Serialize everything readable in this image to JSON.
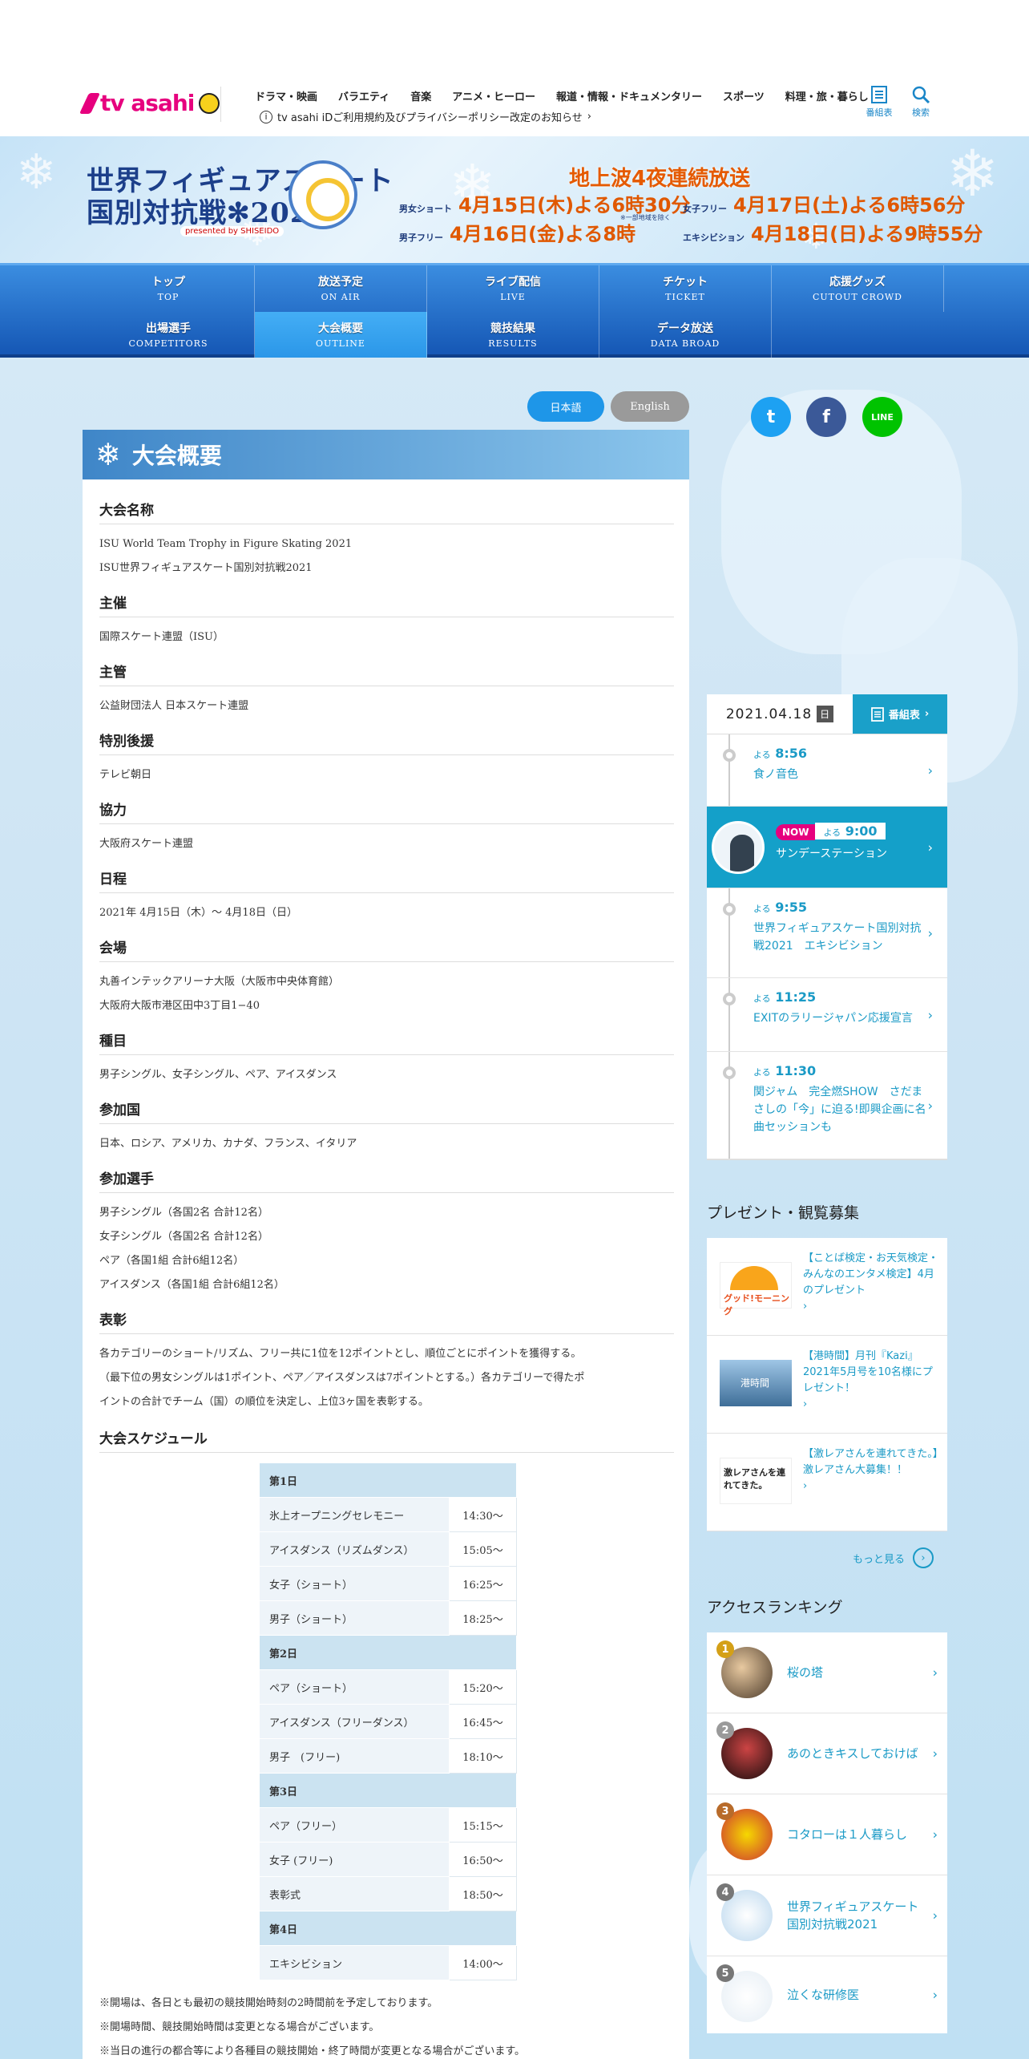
{
  "header": {
    "logo_text": "tv asahi",
    "nav": [
      "ドラマ・映画",
      "バラエティ",
      "音楽",
      "アニメ・ヒーロー",
      "報道・情報・ドキュメンタリー",
      "スポーツ",
      "料理・旅・暮らし"
    ],
    "notice": "tv asahi iDご利用規約及びプライバシーポリシー改定のお知らせ",
    "program_label": "番組表",
    "search_label": "検索"
  },
  "banner": {
    "title_line1": "世界フィギュアスケート",
    "title_line2": "国別対抗戦",
    "title_year": "2021",
    "sponsor": "presented by SHISEIDO",
    "headline": "地上波4夜連続放送",
    "rows": [
      {
        "label": "男女ショート",
        "value": "4月15日(木)よる6時30分",
        "note": "※一部地域を除く"
      },
      {
        "label": "女子フリー",
        "value": "4月17日(土)よる6時56分"
      },
      {
        "label": "男子フリー",
        "value": "4月16日(金)よる8時"
      },
      {
        "label": "エキシビション",
        "value": "4月18日(日)よる9時55分"
      }
    ]
  },
  "nav": [
    {
      "jp": "トップ",
      "en": "TOP"
    },
    {
      "jp": "放送予定",
      "en": "ON AIR"
    },
    {
      "jp": "ライブ配信",
      "en": "LIVE"
    },
    {
      "jp": "チケット",
      "en": "TICKET"
    },
    {
      "jp": "応援グッズ",
      "en": "CUTOUT CROWD"
    },
    {
      "jp": "出場選手",
      "en": "COMPETITORS"
    },
    {
      "jp": "大会概要",
      "en": "OUTLINE"
    },
    {
      "jp": "競技結果",
      "en": "RESULTS"
    },
    {
      "jp": "データ放送",
      "en": "DATA BROAD"
    }
  ],
  "lang": {
    "ja": "日本語",
    "en": "English"
  },
  "content": {
    "title": "大会概要",
    "sections": [
      {
        "h": "大会名称",
        "lines": [
          "ISU World Team Trophy in Figure Skating 2021",
          "ISU世界フィギュアスケート国別対抗戦2021"
        ]
      },
      {
        "h": "主催",
        "lines": [
          "国際スケート連盟（ISU）"
        ]
      },
      {
        "h": "主管",
        "lines": [
          "公益財団法人 日本スケート連盟"
        ]
      },
      {
        "h": "特別後援",
        "lines": [
          "テレビ朝日"
        ]
      },
      {
        "h": "協力",
        "lines": [
          "大阪府スケート連盟"
        ]
      },
      {
        "h": "日程",
        "lines": [
          "2021年 4月15日（木）～ 4月18日（日）"
        ]
      },
      {
        "h": "会場",
        "lines": [
          "丸善インテックアリーナ大阪（大阪市中央体育館）",
          "大阪府大阪市港区田中3丁目1−40"
        ]
      },
      {
        "h": "種目",
        "lines": [
          "男子シングル、女子シングル、ペア、アイスダンス"
        ]
      },
      {
        "h": "参加国",
        "lines": [
          "日本、ロシア、アメリカ、カナダ、フランス、イタリア"
        ]
      },
      {
        "h": "参加選手",
        "lines": [
          "男子シングル（各国2名 合計12名）",
          "女子シングル（各国2名 合計12名）",
          "ペア（各国1組 合計6組12名）",
          "アイスダンス（各国1組 合計6組12名）"
        ]
      },
      {
        "h": "表彰",
        "lines": [
          "各カテゴリーのショート/リズム、フリー共に1位を12ポイントとし、順位ごとにポイントを獲得する。",
          "（最下位の男女シングルは1ポイント、ペア／アイスダンスは7ポイントとする。）各カテゴリーで得たポ",
          "イントの合計でチーム（国）の順位を決定し、上位3ヶ国を表彰する。"
        ]
      }
    ],
    "schedule_heading": "大会スケジュール",
    "schedule": [
      {
        "day": "第1日",
        "events": [
          [
            "氷上オープニングセレモニー",
            "14:30～"
          ],
          [
            "アイスダンス（リズムダンス）",
            "15:05～"
          ],
          [
            "女子（ショート）",
            "16:25～"
          ],
          [
            "男子（ショート）",
            "18:25～"
          ]
        ]
      },
      {
        "day": "第2日",
        "events": [
          [
            "ペア（ショート）",
            "15:20～"
          ],
          [
            "アイスダンス（フリーダンス）",
            "16:45～"
          ],
          [
            "男子　(フリー)",
            "18:10～"
          ]
        ]
      },
      {
        "day": "第3日",
        "events": [
          [
            "ペア（フリー）",
            "15:15～"
          ],
          [
            "女子 (フリー)",
            "16:50～"
          ],
          [
            "表彰式",
            "18:50～"
          ]
        ]
      },
      {
        "day": "第4日",
        "events": [
          [
            "エキシビション",
            "14:00～"
          ]
        ]
      }
    ],
    "notes": [
      "※開場は、各日とも最初の競技開始時刻の2時間前を予定しております。",
      "※開場時間、競技開始時間は変更となる場合がございます。",
      "※当日の進行の都合等により各種目の競技開始・終了時間が変更となる場合がございます。"
    ]
  },
  "timetable": {
    "date": "2021.04.18",
    "dow": "日",
    "button": "番組表",
    "rows": [
      {
        "prefix": "よる",
        "time": "8:56",
        "title": "食ノ音色"
      },
      {
        "prefix": "よる",
        "time": "9:00",
        "title": "サンデーステーション",
        "now": "NOW"
      },
      {
        "prefix": "よる",
        "time": "9:55",
        "title": "世界フィギュアスケート国別対抗戦2021　エキシビション"
      },
      {
        "prefix": "よる",
        "time": "11:25",
        "title": "EXITのラリージャパン応援宣言"
      },
      {
        "prefix": "よる",
        "time": "11:30",
        "title": "関ジャム　完全燃SHOW　さだまさしの「今」に迫る!即興企画に名曲セッションも"
      }
    ]
  },
  "present": {
    "title": "プレゼント・観覧募集",
    "items": [
      "【ことば検定・お天気検定・みんなのエンタメ検定】4月のプレゼント",
      "【港時間】月刊『Kazi』2021年5月号を10名様にプレゼント！",
      "【激レアさんを連れてきた。】激レアさん大募集！！"
    ],
    "thumb_labels": [
      "グッド!モーニング",
      "港時間",
      "激レアさんを連れてきた。"
    ],
    "more": "もっと見る"
  },
  "ranking": {
    "title": "アクセスランキング",
    "items": [
      "桜の塔",
      "あのときキスしておけば",
      "コタローは１人暮らし",
      "世界フィギュアスケート国別対抗戦2021",
      "泣くな研修医"
    ],
    "ranks": [
      "1",
      "2",
      "3",
      "4",
      "5"
    ]
  },
  "colors": {
    "brand": "#e6007e",
    "accent": "#1a9ac6",
    "nav": "#1f6bc6"
  }
}
